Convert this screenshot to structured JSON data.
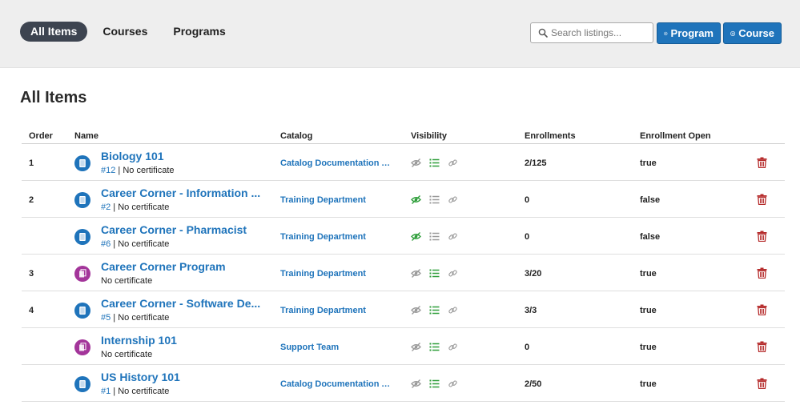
{
  "tabs": [
    {
      "label": "All Items",
      "active": true
    },
    {
      "label": "Courses",
      "active": false
    },
    {
      "label": "Programs",
      "active": false
    }
  ],
  "search": {
    "placeholder": "Search listings..."
  },
  "buttons": {
    "program": "Program",
    "course": "Course"
  },
  "page_title": "All Items",
  "columns": [
    "Order",
    "Name",
    "Catalog",
    "Visibility",
    "Enrollments",
    "Enrollment Open"
  ],
  "colors": {
    "accent": "#1f74bb",
    "active_tab": "#3d4450",
    "program_icon": "#a3359a",
    "visible_green": "#2e9e3a",
    "muted_gray": "#9a9a9a",
    "delete_red": "#b52a2a"
  },
  "rows": [
    {
      "order": "1",
      "type": "course",
      "name": "Biology 101",
      "number": "#12",
      "cert": "No certificate",
      "catalog": "Catalog Documentation A...",
      "eye": "hidden",
      "list": "on",
      "enrollments": "2/125",
      "open": "true"
    },
    {
      "order": "2",
      "type": "course",
      "name": "Career Corner - Information ...",
      "number": "#2",
      "cert": "No certificate",
      "catalog": "Training Department",
      "eye": "visible",
      "list": "off",
      "enrollments": "0",
      "open": "false"
    },
    {
      "order": "",
      "type": "course",
      "name": "Career Corner - Pharmacist",
      "number": "#6",
      "cert": "No certificate",
      "catalog": "Training Department",
      "eye": "visible",
      "list": "off",
      "enrollments": "0",
      "open": "false"
    },
    {
      "order": "3",
      "type": "program",
      "name": "Career Corner Program",
      "number": "",
      "cert": "No certificate",
      "catalog": "Training Department",
      "eye": "hidden",
      "list": "on",
      "enrollments": "3/20",
      "open": "true"
    },
    {
      "order": "4",
      "type": "course",
      "name": "Career Corner - Software De...",
      "number": "#5",
      "cert": "No certificate",
      "catalog": "Training Department",
      "eye": "hidden",
      "list": "on",
      "enrollments": "3/3",
      "open": "true"
    },
    {
      "order": "",
      "type": "program",
      "name": "Internship 101",
      "number": "",
      "cert": "No certificate",
      "catalog": "Support Team",
      "eye": "hidden",
      "list": "on",
      "enrollments": "0",
      "open": "true"
    },
    {
      "order": "",
      "type": "course",
      "name": "US History 101",
      "number": "#1",
      "cert": "No certificate",
      "catalog": "Catalog Documentation A...",
      "eye": "hidden",
      "list": "on",
      "enrollments": "2/50",
      "open": "true"
    }
  ]
}
